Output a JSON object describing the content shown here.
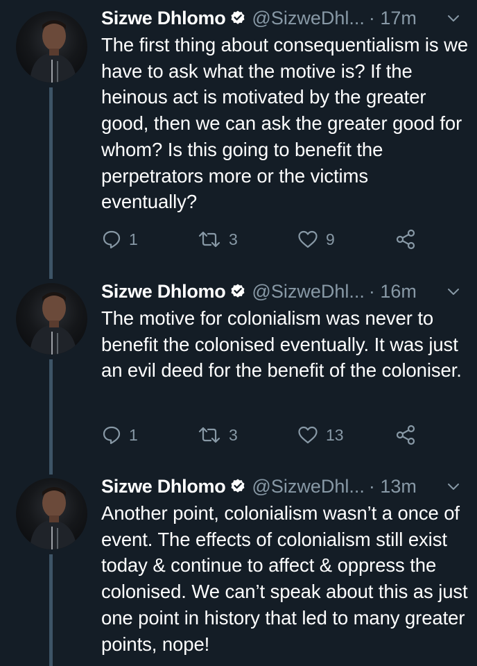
{
  "colors": {
    "background": "#141d26",
    "text": "#ffffff",
    "secondary": "#8899a6",
    "verified": "#ffffff",
    "thread_line": "#3d5466"
  },
  "tweets": [
    {
      "name": "Sizwe Dhlomo",
      "handle": "@SizweDhl...",
      "time": "· 17m",
      "text": "The first thing about consequentialism is we have to ask what the motive is? If the heinous act is motivated by the greater good, then we can ask the greater good for whom? Is this going to benefit the perpetrators more or the victims eventually?",
      "replies": "1",
      "retweets": "3",
      "likes": "9"
    },
    {
      "name": "Sizwe Dhlomo",
      "handle": "@SizweDhl...",
      "time": "· 16m",
      "text": "The motive for colonialism was never to benefit the colonised eventually. It was just an evil deed for the benefit of the coloniser.",
      "replies": "1",
      "retweets": "3",
      "likes": "13"
    },
    {
      "name": "Sizwe Dhlomo",
      "handle": "@SizweDhl...",
      "time": "· 13m",
      "text": "Another point, colonialism wasn’t a once of event. The effects of colonialism still exist today & continue to affect & oppress the colonised. We can’t speak about this as just one point in history that led to many greater points, nope!",
      "replies": "",
      "retweets": "",
      "likes": ""
    }
  ]
}
